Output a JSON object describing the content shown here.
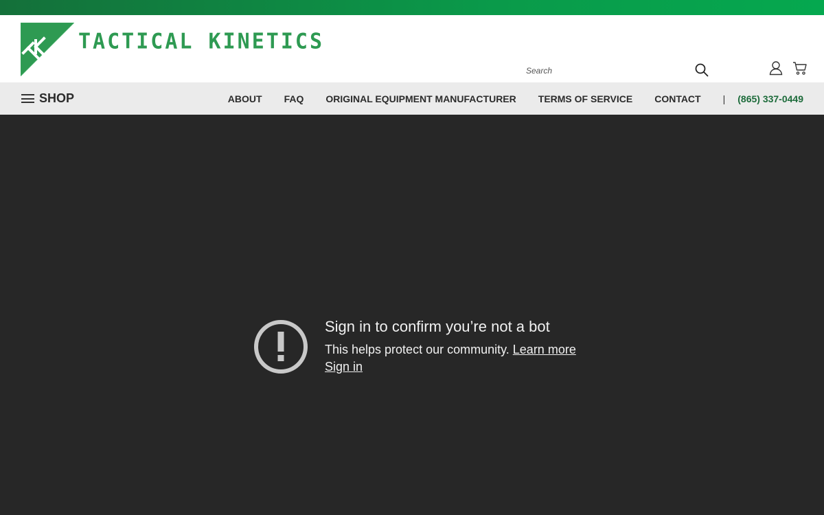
{
  "header": {
    "brand_name": "TACTICAL KINETICS",
    "logo_monogram": "TK",
    "search": {
      "placeholder": "Search"
    },
    "icons": {
      "search": "search-icon",
      "account": "user-icon",
      "cart": "cart-icon"
    }
  },
  "nav": {
    "shop_label": "SHOP",
    "links": [
      {
        "label": "ABOUT"
      },
      {
        "label": "FAQ"
      },
      {
        "label": "ORIGINAL EQUIPMENT MANUFACTURER"
      },
      {
        "label": "TERMS OF SERVICE"
      },
      {
        "label": "CONTACT"
      }
    ],
    "separator": "|",
    "phone": "(865) 337-0449"
  },
  "notice": {
    "icon": "exclamation-circle-icon",
    "title": "Sign in to confirm you’re not a bot",
    "description": "This helps protect our community.",
    "learn_more": "Learn more",
    "sign_in": "Sign in"
  },
  "colors": {
    "brand_green": "#2e9a52",
    "top_strip": "#0a9a4a",
    "phone_green": "#1c6b3a",
    "nav_bg": "#ebebeb",
    "overlay_bg": "#272727",
    "notice_text": "#f1f1f1"
  }
}
